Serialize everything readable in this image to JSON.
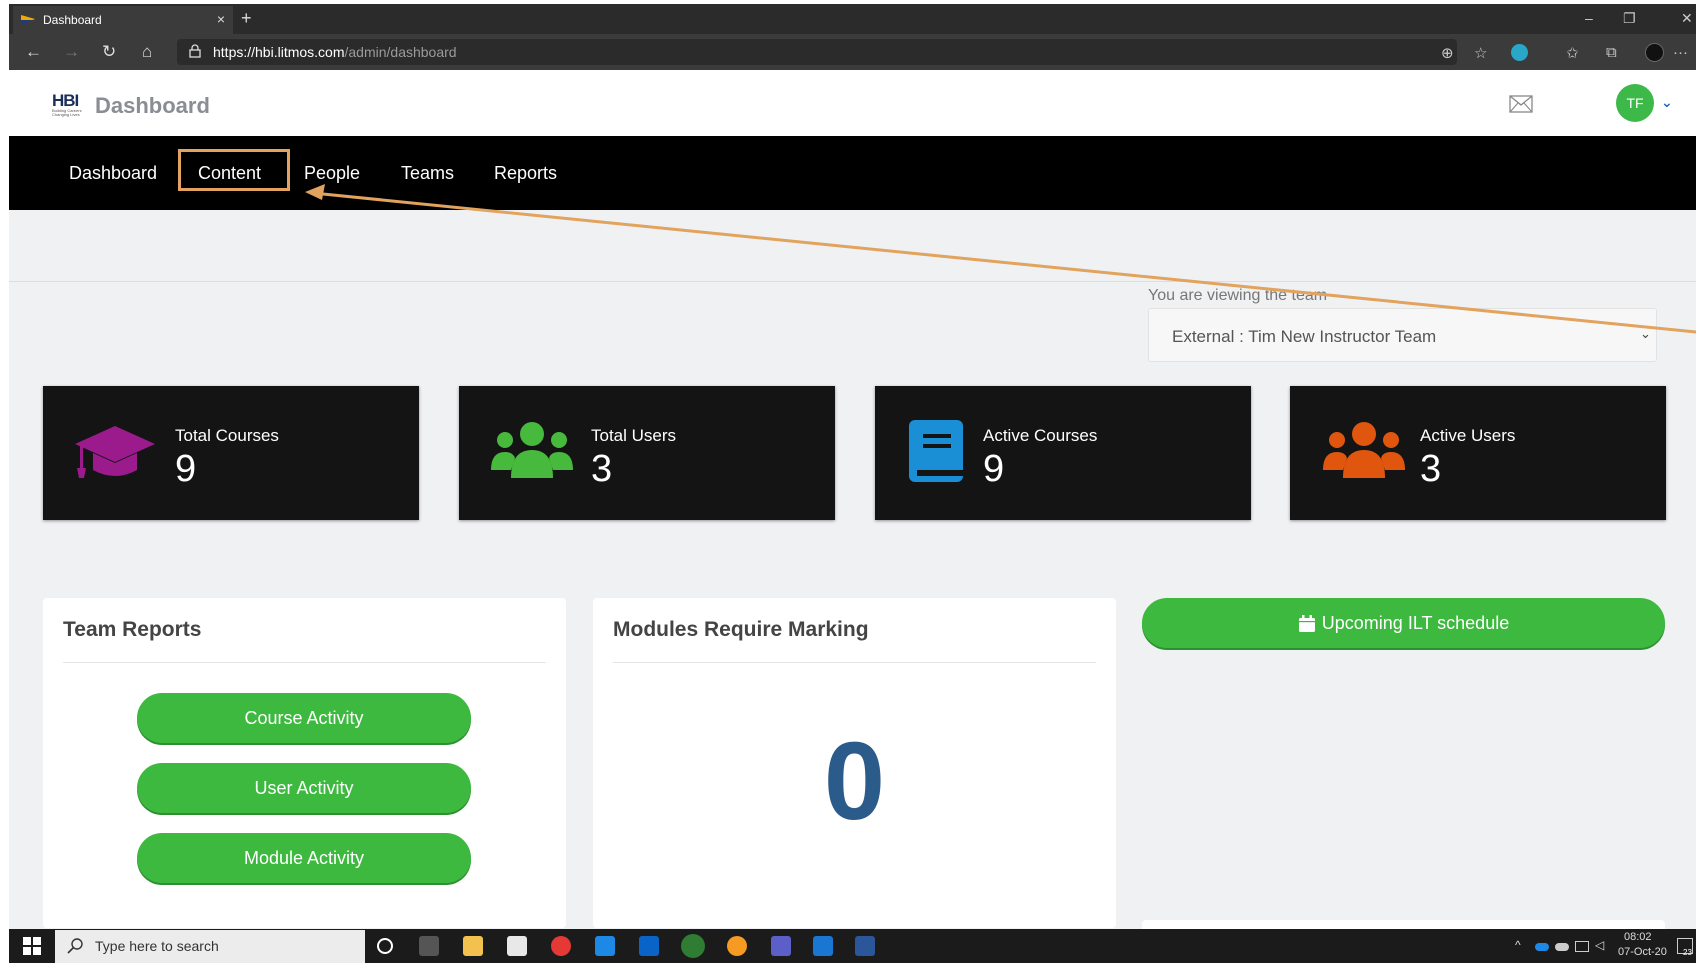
{
  "browser": {
    "tab_title": "Dashboard",
    "tab_close": "×",
    "new_tab": "+",
    "window_buttons": {
      "minimize": "–",
      "restore": "❐",
      "close": "✕"
    },
    "nav": {
      "back": "←",
      "forward": "→",
      "refresh": "↻",
      "home": "⌂"
    },
    "url_host": "https://hbi.litmos.com",
    "url_path": "/admin/dashboard",
    "toolbar": {
      "zoom": "⊕",
      "favorite": "☆",
      "favorites": "✩",
      "collections": "⧉",
      "more": "···"
    }
  },
  "header": {
    "logo_text": "HBI",
    "logo_tagline": "Building Careers Changing Lives",
    "title": "Dashboard",
    "avatar_initials": "TF",
    "avatar_chevron": "⌄"
  },
  "nav": {
    "items": [
      "Dashboard",
      "Content",
      "People",
      "Teams",
      "Reports"
    ]
  },
  "team": {
    "label": "You are viewing the team",
    "selected": "External : Tim New Instructor Team",
    "chevron": "⌄"
  },
  "stats": [
    {
      "label": "Total Courses",
      "value": "9",
      "icon": "graduation-cap-icon",
      "color": "#9b1b8c"
    },
    {
      "label": "Total Users",
      "value": "3",
      "icon": "users-icon",
      "color": "#47b93d"
    },
    {
      "label": "Active Courses",
      "value": "9",
      "icon": "book-icon",
      "color": "#1a8fd6"
    },
    {
      "label": "Active Users",
      "value": "3",
      "icon": "users-icon",
      "color": "#e0560f"
    }
  ],
  "team_reports": {
    "title": "Team Reports",
    "buttons": [
      "Course Activity",
      "User Activity",
      "Module Activity"
    ]
  },
  "modules": {
    "title": "Modules Require Marking",
    "count": "0"
  },
  "ilt": {
    "button": "Upcoming ILT schedule"
  },
  "taskbar": {
    "search_placeholder": "Type here to search",
    "time": "08:02",
    "date": "07-Oct-20",
    "badge": "23"
  },
  "colors": {
    "accent_green": "#3db93f",
    "highlight_orange": "#e1a35e",
    "nav_black": "#000000"
  }
}
